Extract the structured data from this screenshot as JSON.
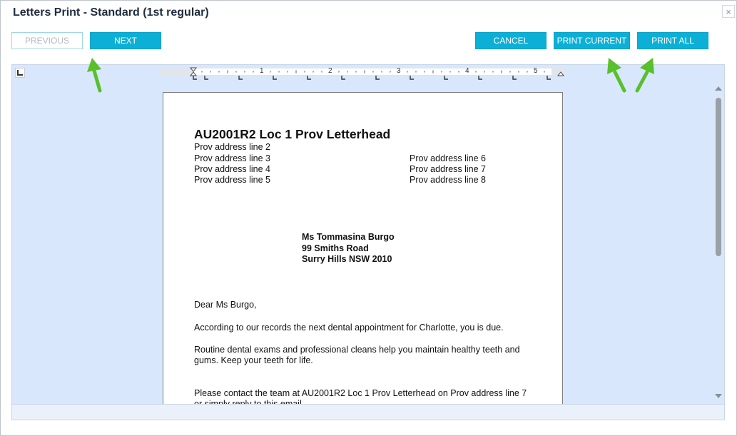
{
  "dialog": {
    "title": "Letters Print - Standard (1st regular)",
    "close_glyph": "×"
  },
  "toolbar": {
    "previous_label": "PREVIOUS",
    "next_label": "NEXT",
    "cancel_label": "CANCEL",
    "print_current_label": "PRINT CURRENT",
    "print_all_label": "PRINT ALL"
  },
  "ruler": {
    "numbers": [
      "1",
      "2",
      "3",
      "4",
      "5"
    ]
  },
  "letter": {
    "letterhead": "AU2001R2 Loc 1 Prov Letterhead",
    "address_left": [
      "Prov address line 2",
      "Prov address line 3",
      "Prov address line 4",
      "Prov address line 5"
    ],
    "address_right": [
      "Prov address line 6",
      "Prov address line 7",
      "Prov address line 8"
    ],
    "recipient": [
      "Ms Tommasina Burgo",
      "99 Smiths Road",
      "Surry Hills NSW 2010"
    ],
    "salutation": "Dear Ms Burgo,",
    "paragraph1": "According to our records the next dental appointment for Charlotte, you is due.",
    "paragraph2_line1": "Routine dental exams and professional cleans help you maintain healthy teeth and",
    "paragraph2_line2": "gums. Keep your teeth for life.",
    "paragraph3_line1": "Please contact the team at AU2001R2 Loc 1 Prov Letterhead on Prov address line 7",
    "paragraph3_line2": "or simply reply to this email."
  },
  "annotations": {
    "arrow_icon": "green-pointer-arrow-icon",
    "arrow_color": "#58c02a"
  },
  "colors": {
    "accent": "#0cb0d6",
    "viewer_background": "#d8e7fb"
  }
}
